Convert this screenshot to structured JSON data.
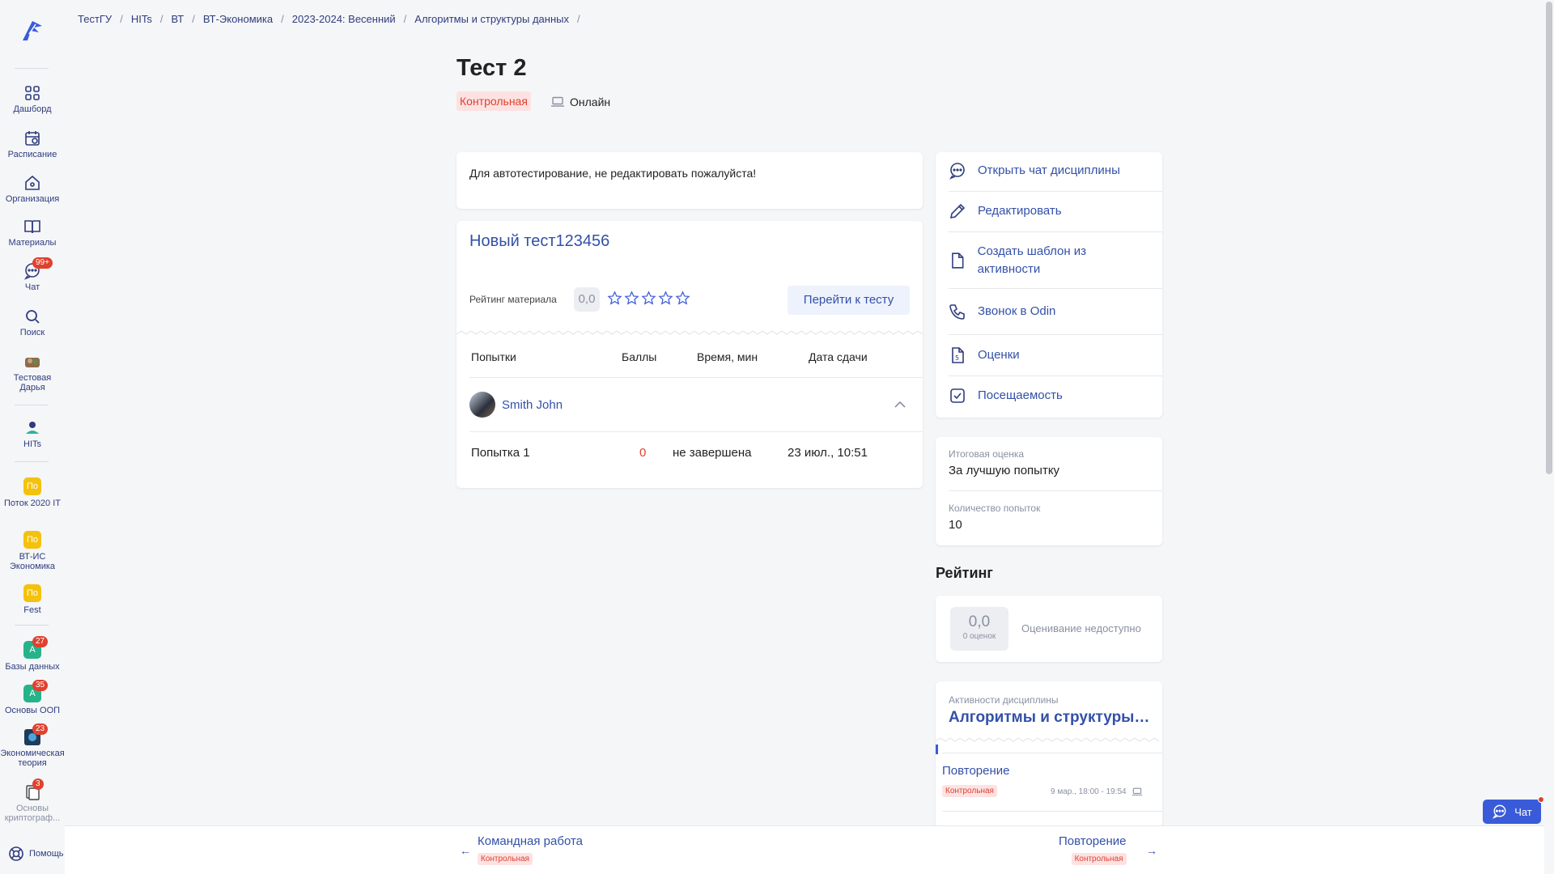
{
  "sidebar": {
    "items": [
      {
        "label": "Дашборд"
      },
      {
        "label": "Расписание"
      },
      {
        "label": "Организация"
      },
      {
        "label": "Материалы"
      },
      {
        "label": "Чат",
        "badge": "99+"
      },
      {
        "label": "Поиск"
      },
      {
        "label": "Тестовая Дарья"
      },
      {
        "label": "HITs"
      },
      {
        "label": "Поток 2020 IT",
        "short": "По",
        "color": "#f4c20d"
      },
      {
        "label": "ВТ-ИС Экономика",
        "short": "По",
        "color": "#f4c20d"
      },
      {
        "label": "Fest",
        "short": "По",
        "color": "#f4c20d"
      },
      {
        "label": "Базы данных",
        "short": "А",
        "color": "#26b38a",
        "badge": "27"
      },
      {
        "label": "Основы ООП",
        "short": "А",
        "color": "#26b38a",
        "badge": "35"
      },
      {
        "label": "Экономическая теория",
        "badge": "23"
      },
      {
        "label": "Основы криптограф...",
        "badge": "3"
      }
    ],
    "help": "Помощь"
  },
  "breadcrumbs": [
    "ТестГУ",
    "HITs",
    "ВТ",
    "ВТ-Экономика",
    "2023-2024: Весенний",
    "Алгоритмы и структуры данных"
  ],
  "page": {
    "title": "Тест 2",
    "type_tag": "Контрольная",
    "format": "Онлайн",
    "description": "Для автотестирование, не редактировать пожалуйста!"
  },
  "material": {
    "title": "Новый тест123456",
    "rating_label": "Рейтинг материала",
    "rating_value": "0,0",
    "stars_filled": 0,
    "go_button": "Перейти к тесту",
    "columns": [
      "Попытки",
      "Баллы",
      "Время, мин",
      "Дата сдачи"
    ],
    "user": "Smith John",
    "attempts": [
      {
        "name": "Попытка 1",
        "score": "0",
        "time": "не завершена",
        "date": "23 июл., 10:51"
      }
    ]
  },
  "actions": [
    {
      "label": "Открыть чат дисциплины",
      "icon": "chat-icon"
    },
    {
      "label": "Редактировать",
      "icon": "pencil-icon"
    },
    {
      "label": "Создать шаблон из активности",
      "icon": "file-icon"
    },
    {
      "label": "Звонок в Odin",
      "icon": "phone-icon"
    },
    {
      "label": "Оценки",
      "icon": "grades-icon"
    },
    {
      "label": "Посещаемость",
      "icon": "checkbox-icon"
    }
  ],
  "info": {
    "final_label": "Итоговая оценка",
    "final_value": "За лучшую попытку",
    "attempts_label": "Количество попыток",
    "attempts_value": "10"
  },
  "rating": {
    "heading": "Рейтинг",
    "value": "0,0",
    "count": "0 оценок",
    "status": "Оценивание недоступно"
  },
  "discipline": {
    "label": "Активности дисциплины",
    "name": "Алгоритмы и структуры данных",
    "item_title": "Повторение",
    "item_tag": "Контрольная",
    "item_time": "9 мар., 18:00 - 19:54"
  },
  "bottom_nav": {
    "prev_title": "Командная работа",
    "prev_tag": "Контрольная",
    "next_title": "Повторение",
    "next_tag": "Контрольная"
  },
  "chat_button": "Чат",
  "colors": {
    "accent": "#3350a8",
    "danger": "#e0412e",
    "tag_bg": "#fde2e2",
    "primary_button": "#3a5bd9"
  }
}
